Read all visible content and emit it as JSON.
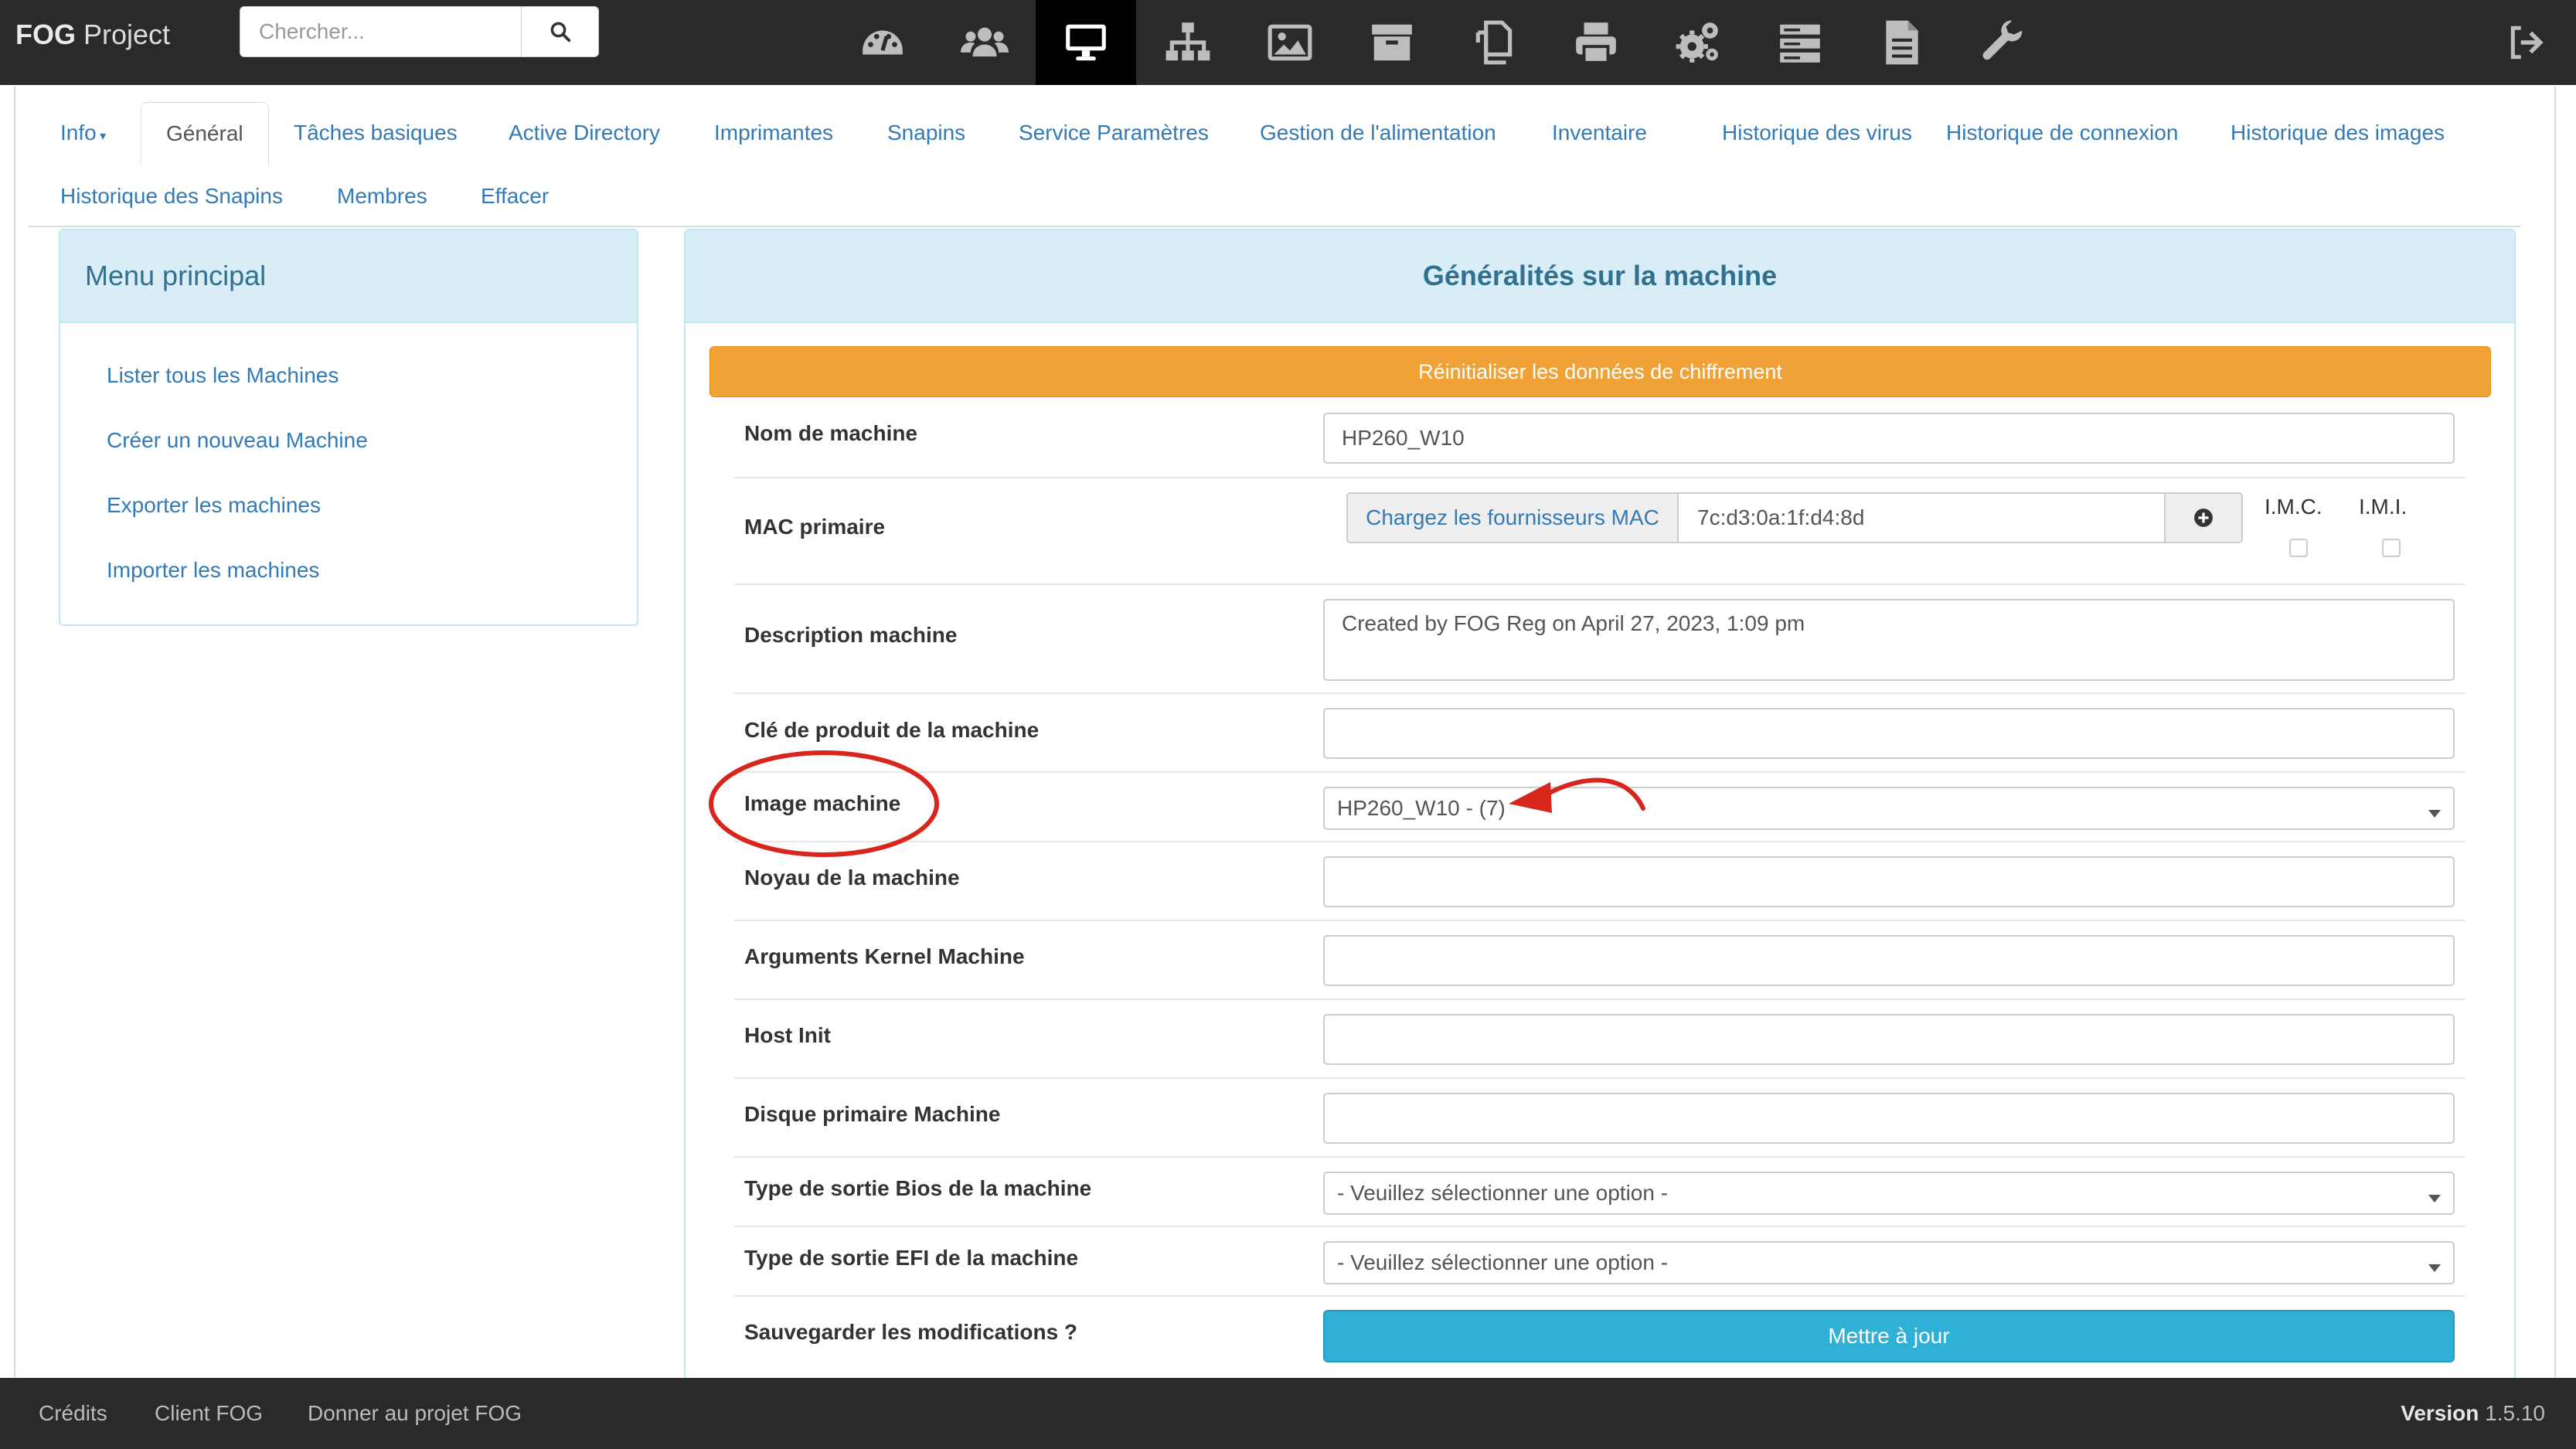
{
  "brand": {
    "bold": "FOG",
    "rest": " Project"
  },
  "search": {
    "placeholder": "Chercher..."
  },
  "nav_icons": [
    "dashboard-icon",
    "users-icon",
    "desktop-icon",
    "sitemap-icon",
    "image-icon",
    "archive-icon",
    "copy-icon",
    "print-icon",
    "gears-icon",
    "server-icon",
    "file-icon",
    "wrench-icon"
  ],
  "tabs": {
    "info": "Info",
    "general": "Général",
    "basic_tasks": "Tâches basiques",
    "active_directory": "Active Directory",
    "printers": "Imprimantes",
    "snapins": "Snapins",
    "service": "Service Paramètres",
    "power": "Gestion de l'alimentation",
    "inventory": "Inventaire",
    "virus": "Historique des virus",
    "login": "Historique de connexion",
    "images": "Historique des images",
    "snapin_history": "Historique des Snapins",
    "members": "Membres",
    "delete": "Effacer"
  },
  "sidebar": {
    "title": "Menu principal",
    "items": [
      "Lister tous les Machines",
      "Créer un nouveau Machine",
      "Exporter les machines",
      "Importer les machines"
    ]
  },
  "main": {
    "title": "Généralités sur la machine",
    "reset_label": "Réinitialiser les données de chiffrement",
    "labels": {
      "name": "Nom de machine",
      "mac": "MAC primaire",
      "description": "Description machine",
      "product_key": "Clé de produit de la machine",
      "image": "Image machine",
      "kernel": "Noyau de la machine",
      "kernel_args": "Arguments Kernel Machine",
      "init": "Host Init",
      "disk": "Disque primaire Machine",
      "bios": "Type de sortie Bios de la machine",
      "efi": "Type de sortie EFI de la machine",
      "save": "Sauvegarder les modifications ?"
    },
    "values": {
      "name": "HP260_W10",
      "mac_vendor_btn": "Chargez les fournisseurs MAC",
      "mac": "7c:d3:0a:1f:d4:8d",
      "imc_label": "I.M.C.",
      "imi_label": "I.M.I.",
      "description": "Created by FOG Reg on April 27, 2023, 1:09 pm",
      "product_key": "",
      "image": "HP260_W10 - (7)",
      "kernel": "",
      "kernel_args": "",
      "init": "",
      "disk": "",
      "bios": "- Veuillez sélectionner une option -",
      "efi": "- Veuillez sélectionner une option -"
    },
    "update_label": "Mettre à jour"
  },
  "annotation_color": "#d9261c",
  "footer": {
    "credits": "Crédits",
    "client": "Client FOG",
    "donate": "Donner au projet FOG",
    "version_label": "Version",
    "version_value": " 1.5.10"
  }
}
